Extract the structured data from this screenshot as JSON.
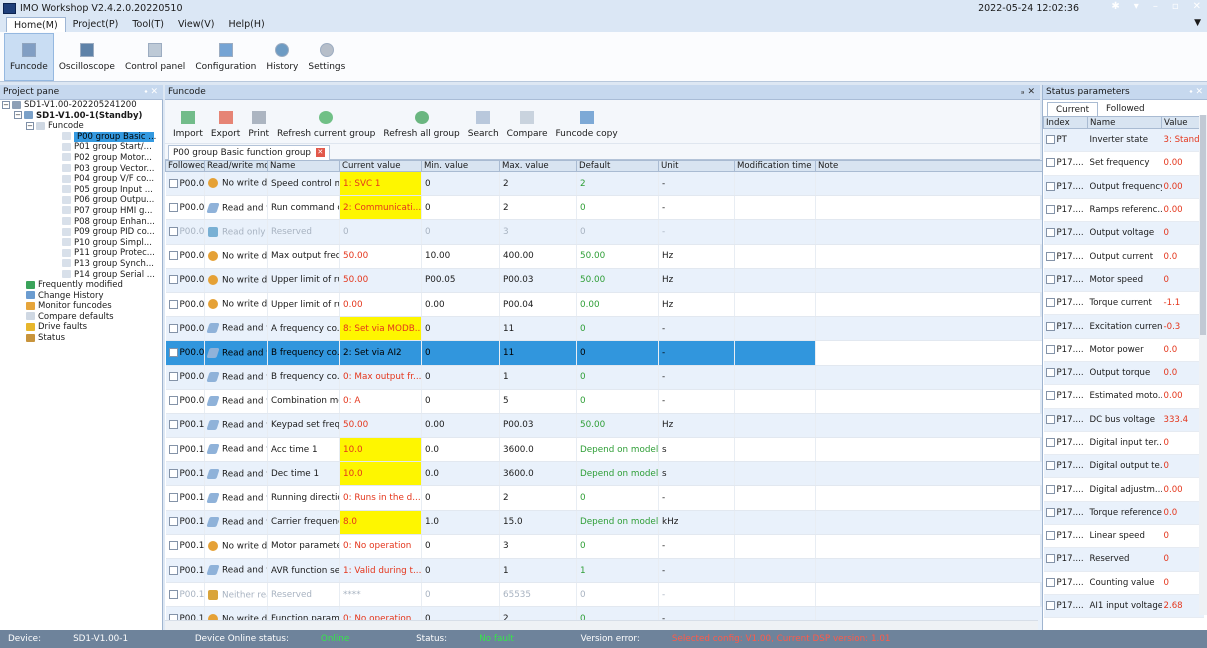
{
  "app": {
    "title": "IMO Workshop V2.4.2.0.20220510",
    "clock": "2022-05-24 12:02:36"
  },
  "menu": [
    {
      "label": "Home(M)"
    },
    {
      "label": "Project(P)"
    },
    {
      "label": "Tool(T)"
    },
    {
      "label": "View(V)"
    },
    {
      "label": "Help(H)"
    }
  ],
  "ribbon": [
    {
      "label": "Funcode",
      "icon": "funcode-icon"
    },
    {
      "label": "Oscilloscope",
      "icon": "oscilloscope-icon"
    },
    {
      "label": "Control panel",
      "icon": "control-panel-icon"
    },
    {
      "label": "Configuration",
      "icon": "configuration-icon"
    },
    {
      "label": "History",
      "icon": "history-icon"
    },
    {
      "label": "Settings",
      "icon": "settings-icon"
    }
  ],
  "project_pane": {
    "title": "Project pane",
    "tree": [
      {
        "label": "SD1-V1.00-202205241200",
        "level": 0,
        "box": "−"
      },
      {
        "label": "SD1-V1.00-1(Standby)",
        "level": 1,
        "box": "−",
        "bold": true
      },
      {
        "label": "Funcode",
        "level": 2,
        "box": "−"
      },
      {
        "label": "P00 group Basic ...",
        "level": 3,
        "selected": true
      },
      {
        "label": "P01 group Start/...",
        "level": 3
      },
      {
        "label": "P02 group Motor...",
        "level": 3
      },
      {
        "label": "P03 group Vector...",
        "level": 3
      },
      {
        "label": "P04 group V/F co...",
        "level": 3
      },
      {
        "label": "P05 group Input ...",
        "level": 3
      },
      {
        "label": "P06 group Outpu...",
        "level": 3
      },
      {
        "label": "P07 group HMI g...",
        "level": 3
      },
      {
        "label": "P08 group Enhan...",
        "level": 3
      },
      {
        "label": "P09 group PID co...",
        "level": 3
      },
      {
        "label": "P10 group Simpl...",
        "level": 3
      },
      {
        "label": "P11 group Protec...",
        "level": 3
      },
      {
        "label": "P13 group Synch...",
        "level": 3
      },
      {
        "label": "P14 group Serial ...",
        "level": 3
      },
      {
        "label": "Frequently modified",
        "level": 2
      },
      {
        "label": "Change History",
        "level": 2
      },
      {
        "label": "Monitor funcodes",
        "level": 2
      },
      {
        "label": "Compare defaults",
        "level": 2
      },
      {
        "label": "Drive faults",
        "level": 2
      },
      {
        "label": "Status",
        "level": 2
      }
    ]
  },
  "funcode": {
    "pane_title": "Funcode",
    "toolbar": [
      {
        "label": "Import",
        "icon": "import-icon"
      },
      {
        "label": "Export",
        "icon": "export-icon"
      },
      {
        "label": "Print",
        "icon": "print-icon"
      },
      {
        "label": "Refresh current group",
        "icon": "refresh-current-icon"
      },
      {
        "label": "Refresh all group",
        "icon": "refresh-all-icon"
      },
      {
        "label": "Search",
        "icon": "search-icon"
      },
      {
        "label": "Compare",
        "icon": "compare-icon"
      },
      {
        "label": "Funcode copy",
        "icon": "funcode-copy-icon"
      }
    ],
    "tab": "P00 group Basic function group",
    "columns": [
      "Followed",
      "Read/write mode",
      "Name",
      "Current value",
      "Min. value",
      "Max. value",
      "Default",
      "Unit",
      "Modification time",
      "Note"
    ],
    "rows": [
      {
        "code": "P00.00",
        "mode": "No write dur...",
        "mode_icon": "no-write-icon",
        "name": "Speed control m...",
        "current": "1: SVC 1",
        "min": "0",
        "max": "2",
        "default": "2",
        "unit": "-",
        "cur_yellow": true,
        "cur_red": true,
        "def_green": true
      },
      {
        "code": "P00.01",
        "mode": "Read and w...",
        "mode_icon": "edit-icon",
        "name": "Run command c...",
        "current": "2: Communicati...",
        "min": "0",
        "max": "2",
        "default": "0",
        "unit": "-",
        "cur_yellow": true,
        "cur_red": true,
        "def_green": true
      },
      {
        "code": "P00.02",
        "mode": "Read only",
        "mode_icon": "read-only-icon",
        "name": "Reserved",
        "current": "0",
        "min": "0",
        "max": "3",
        "default": "0",
        "unit": "-",
        "dim": true,
        "cur_red": true,
        "def_green": true
      },
      {
        "code": "P00.03",
        "mode": "No write dur...",
        "mode_icon": "no-write-icon",
        "name": "Max output freq...",
        "current": "50.00",
        "min": "10.00",
        "max": "400.00",
        "default": "50.00",
        "unit": "Hz",
        "cur_red": true,
        "def_green": true
      },
      {
        "code": "P00.04",
        "mode": "No write dur...",
        "mode_icon": "no-write-icon",
        "name": "Upper limit of ru...",
        "current": "50.00",
        "min": "P00.05",
        "max": "P00.03",
        "default": "50.00",
        "unit": "Hz",
        "cur_red": true,
        "def_green": true
      },
      {
        "code": "P00.05",
        "mode": "No write dur...",
        "mode_icon": "no-write-icon",
        "name": "Upper limit of ru...",
        "current": "0.00",
        "min": "0.00",
        "max": "P00.04",
        "default": "0.00",
        "unit": "Hz",
        "cur_red": true,
        "def_green": true
      },
      {
        "code": "P00.06",
        "mode": "Read and w...",
        "mode_icon": "edit-icon",
        "name": "A frequency co...",
        "current": "8: Set via MODB...",
        "min": "0",
        "max": "11",
        "default": "0",
        "unit": "-",
        "cur_yellow": true,
        "cur_red": true,
        "def_green": true
      },
      {
        "code": "P00.07",
        "mode": "Read and w...",
        "mode_icon": "edit-icon",
        "name": "B frequency co...",
        "current": "2: Set via AI2",
        "min": "0",
        "max": "11",
        "default": "0",
        "unit": "-",
        "selected": true
      },
      {
        "code": "P00.08",
        "mode": "Read and w...",
        "mode_icon": "edit-icon",
        "name": "B frequency co...",
        "current": "0: Max output fr...",
        "min": "0",
        "max": "1",
        "default": "0",
        "unit": "-",
        "cur_red": true,
        "def_green": true
      },
      {
        "code": "P00.09",
        "mode": "Read and w...",
        "mode_icon": "edit-icon",
        "name": "Combination mo...",
        "current": "0: A",
        "min": "0",
        "max": "5",
        "default": "0",
        "unit": "-",
        "cur_red": true,
        "def_green": true
      },
      {
        "code": "P00.10",
        "mode": "Read and w...",
        "mode_icon": "edit-icon",
        "name": "Keypad set freq...",
        "current": "50.00",
        "min": "0.00",
        "max": "P00.03",
        "default": "50.00",
        "unit": "Hz",
        "cur_red": true,
        "def_green": true
      },
      {
        "code": "P00.11",
        "mode": "Read and w...",
        "mode_icon": "edit-icon",
        "name": "Acc time 1",
        "current": "10.0",
        "min": "0.0",
        "max": "3600.0",
        "default": "Depend on model",
        "unit": "s",
        "cur_yellow": true,
        "cur_red": true,
        "def_green": true
      },
      {
        "code": "P00.12",
        "mode": "Read and w...",
        "mode_icon": "edit-icon",
        "name": "Dec time 1",
        "current": "10.0",
        "min": "0.0",
        "max": "3600.0",
        "default": "Depend on model",
        "unit": "s",
        "cur_yellow": true,
        "cur_red": true,
        "def_green": true
      },
      {
        "code": "P00.13",
        "mode": "Read and w...",
        "mode_icon": "edit-icon",
        "name": "Running directio...",
        "current": "0: Runs in the d...",
        "min": "0",
        "max": "2",
        "default": "0",
        "unit": "-",
        "cur_red": true,
        "def_green": true
      },
      {
        "code": "P00.14",
        "mode": "Read and w...",
        "mode_icon": "edit-icon",
        "name": "Carrier frequenc...",
        "current": "8.0",
        "min": "1.0",
        "max": "15.0",
        "default": "Depend on model",
        "unit": "kHz",
        "cur_yellow": true,
        "cur_red": true,
        "def_green": true
      },
      {
        "code": "P00.15",
        "mode": "No write dur...",
        "mode_icon": "no-write-icon",
        "name": "Motor paramete...",
        "current": "0: No operation",
        "min": "0",
        "max": "3",
        "default": "0",
        "unit": "-",
        "cur_red": true,
        "def_green": true
      },
      {
        "code": "P00.16",
        "mode": "Read and w...",
        "mode_icon": "edit-icon",
        "name": "AVR function sel...",
        "current": "1: Valid during t...",
        "min": "0",
        "max": "1",
        "default": "1",
        "unit": "-",
        "cur_red": true,
        "def_green": true
      },
      {
        "code": "P00.17",
        "mode": "Neither rea...",
        "mode_icon": "lock-icon",
        "name": "Reserved",
        "current": "****",
        "min": "0",
        "max": "65535",
        "default": "0",
        "unit": "-",
        "dim": true,
        "cur_red": true,
        "def_green": true
      },
      {
        "code": "P00.18",
        "mode": "No write dur...",
        "mode_icon": "no-write-icon",
        "name": "Function param...",
        "current": "0: No operation",
        "min": "0",
        "max": "2",
        "default": "0",
        "unit": "-",
        "cur_red": true,
        "def_green": true
      }
    ]
  },
  "status_params": {
    "title": "Status parameters",
    "tabs": [
      "Current",
      "Followed"
    ],
    "columns": [
      "Index",
      "Name",
      "Value"
    ],
    "rows": [
      {
        "index": "PT",
        "name": "Inverter state",
        "value": "3: Stand"
      },
      {
        "index": "P17....",
        "name": "Set frequency",
        "value": "0.00"
      },
      {
        "index": "P17....",
        "name": "Output frequency",
        "value": "0.00"
      },
      {
        "index": "P17....",
        "name": "Ramps referenc...",
        "value": "0.00"
      },
      {
        "index": "P17....",
        "name": "Output voltage",
        "value": "0"
      },
      {
        "index": "P17....",
        "name": "Output current",
        "value": "0.0"
      },
      {
        "index": "P17....",
        "name": "Motor speed",
        "value": "0"
      },
      {
        "index": "P17....",
        "name": "Torque current",
        "value": "-1.1"
      },
      {
        "index": "P17....",
        "name": "Excitation current",
        "value": "-0.3"
      },
      {
        "index": "P17....",
        "name": "Motor power",
        "value": "0.0"
      },
      {
        "index": "P17....",
        "name": "Output torque",
        "value": "0.0"
      },
      {
        "index": "P17....",
        "name": "Estimated moto...",
        "value": "0.00"
      },
      {
        "index": "P17....",
        "name": "DC bus voltage",
        "value": "333.4"
      },
      {
        "index": "P17....",
        "name": "Digital input ter...",
        "value": "0"
      },
      {
        "index": "P17....",
        "name": "Digital output te...",
        "value": "0"
      },
      {
        "index": "P17....",
        "name": "Digital adjustm...",
        "value": "0.00"
      },
      {
        "index": "P17....",
        "name": "Torque reference",
        "value": "0.0"
      },
      {
        "index": "P17....",
        "name": "Linear speed",
        "value": "0"
      },
      {
        "index": "P17....",
        "name": "Reserved",
        "value": "0"
      },
      {
        "index": "P17....",
        "name": "Counting value",
        "value": "0"
      },
      {
        "index": "P17....",
        "name": "AI1 input voltage",
        "value": "2.68"
      }
    ]
  },
  "statusbar": {
    "device_label": "Device:",
    "device": "SD1-V1.00-1",
    "online_label": "Device Online status:",
    "online": "Online",
    "status_label": "Status:",
    "status": "No fault",
    "version_label": "Version error:",
    "version": "Selected config: V1.00, Current DSP version: 1.01"
  },
  "colors": {
    "accent": "#3196dd",
    "highlight": "#fef600",
    "alert": "#e4361c",
    "ok": "#2e9e36"
  }
}
